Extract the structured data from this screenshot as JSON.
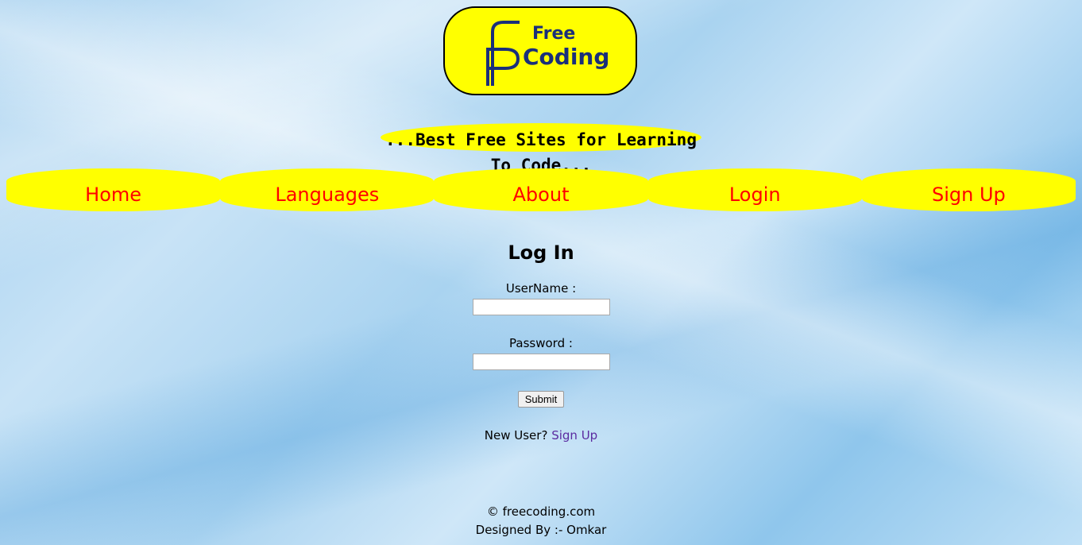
{
  "logo": {
    "line1": "Free",
    "line2": "Coding",
    "icon": "fc-logo-icon",
    "colors": {
      "background": "#ffff00",
      "text": "#1a2f7a"
    }
  },
  "tagline": "...Best Free Sites for Learning To Code...",
  "nav": {
    "items": [
      {
        "label": "Home"
      },
      {
        "label": "Languages"
      },
      {
        "label": "About"
      },
      {
        "label": "Login"
      },
      {
        "label": "Sign Up"
      }
    ],
    "colors": {
      "background": "#ffff00",
      "text": "#ff0000"
    }
  },
  "login": {
    "title": "Log In",
    "username_label": "UserName :",
    "username_value": "",
    "password_label": "Password :",
    "password_value": "",
    "submit_label": "Submit",
    "new_user_text": "New User?",
    "signup_link": "Sign Up"
  },
  "footer": {
    "copyright": "© freecoding.com",
    "designer": "Designed By :- Omkar"
  }
}
